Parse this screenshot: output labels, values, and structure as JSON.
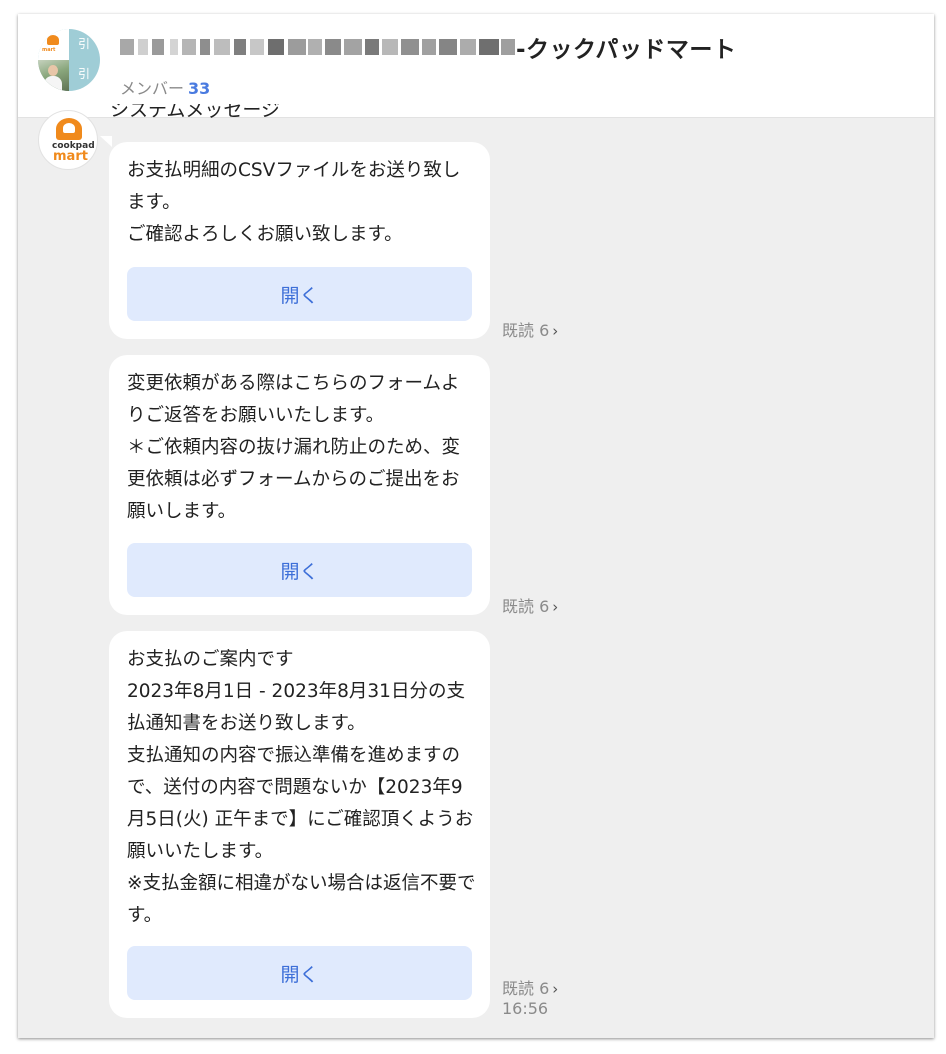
{
  "header": {
    "group_title": "-クックパッドマート",
    "members_label": "メンバー",
    "members_count": "33",
    "avatar_chars": [
      "引",
      "引"
    ]
  },
  "sender": {
    "name": "システムメッセージ",
    "avatar_text_top": "cookpad",
    "avatar_text_bottom": "mart"
  },
  "messages": [
    {
      "text": "お支払明細のCSVファイルをお送り致します。\nご確認よろしくお願い致します。",
      "button_label": "開く",
      "read_label": "既読 6"
    },
    {
      "text": "変更依頼がある際はこちらのフォームよりご返答をお願いいたします。\n＊ご依頼内容の抜け漏れ防止のため、変更依頼は必ずフォームからのご提出をお願いします。",
      "button_label": "開く",
      "read_label": "既読 6"
    },
    {
      "text": "お支払のご案内です\n2023年8月1日 - 2023年8月31日分の支払通知書をお送り致します。\n支払通知の内容で振込準備を進めますので、送付の内容で問題ないか【2023年9月5日(火) 正午まで】にご確認頂くようお願いいたします。\n※支払金額に相違がない場合は返信不要です。",
      "button_label": "開く",
      "read_label": "既読 6",
      "time": "16:56"
    }
  ],
  "colors": {
    "accent": "#4a7be0",
    "button_bg": "#e0eafd",
    "chat_bg": "#efefef",
    "brand_orange": "#f08a1c"
  },
  "icons": {
    "read_chevron": "chevron-right-icon",
    "sender_logo": "cookpad-mart-logo"
  }
}
